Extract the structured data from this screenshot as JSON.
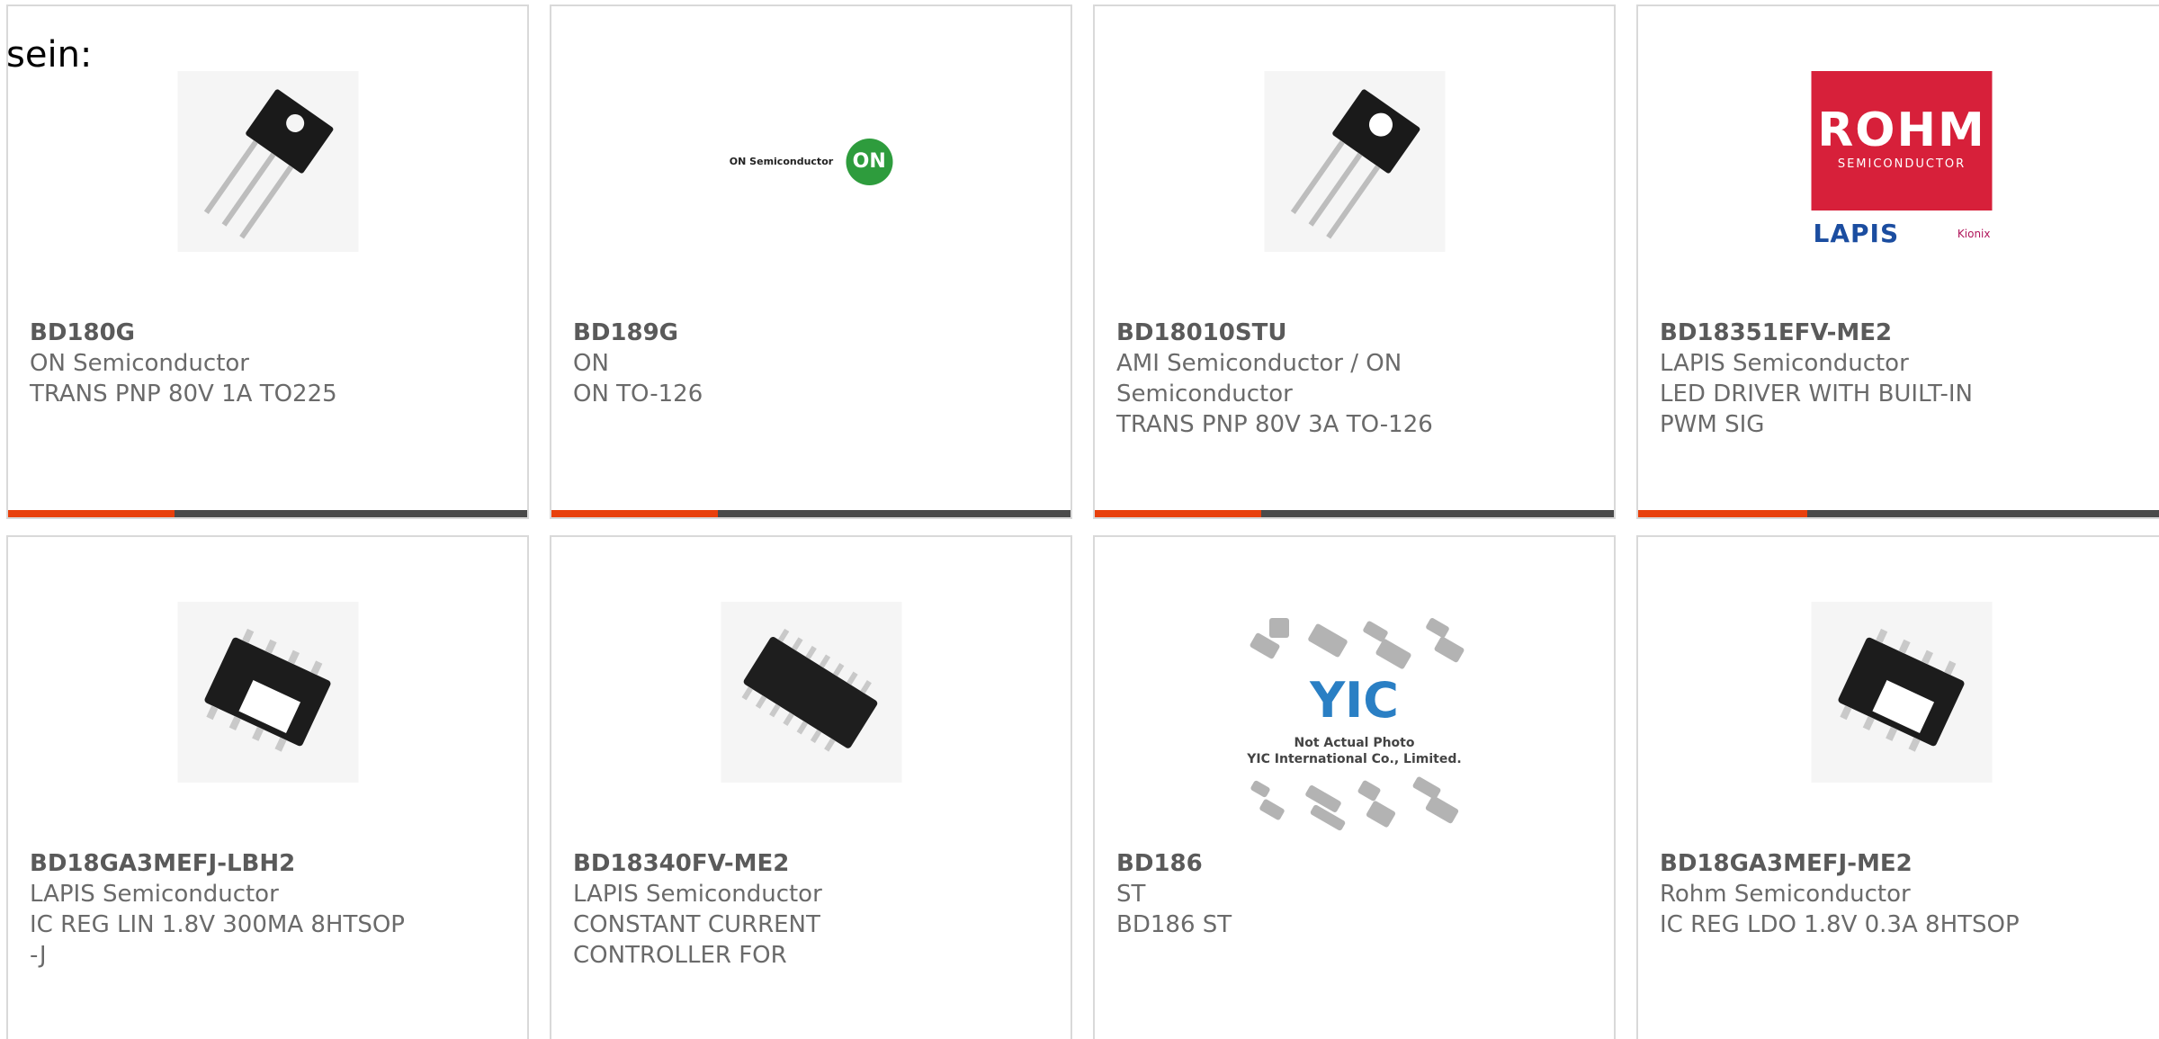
{
  "lead_text": "sein:",
  "colors": {
    "progress_fill": "#e8400c",
    "progress_track": "#4a4a4a",
    "border": "#d9d9d9"
  },
  "cards": [
    {
      "part": "BD180G",
      "maker": "ON Semiconductor",
      "desc": "TRANS PNP 80V 1A TO225",
      "image": "to126-transistor-icon",
      "progress": 0.32
    },
    {
      "part": "BD189G",
      "maker": "ON",
      "desc": "ON TO-126",
      "image": "on-semiconductor-logo",
      "logo_text": "ON Semiconductor",
      "logo_badge": "ON",
      "progress": 0.32
    },
    {
      "part": "BD18010STU",
      "maker": "AMI Semiconductor / ON Semiconductor",
      "desc": "TRANS PNP 80V 3A TO-126",
      "image": "to126-transistor-icon",
      "progress": 0.32
    },
    {
      "part": "BD18351EFV-ME2",
      "maker": "LAPIS Semiconductor",
      "desc": "LED DRIVER WITH BUILT-IN PWM SIG",
      "image": "rohm-lapis-kionix-logo",
      "logo_big": "ROHM",
      "logo_small": "SEMICONDUCTOR",
      "logo_lapis": "LAPIS",
      "logo_kionix": "Kionix",
      "progress": 0.32
    },
    {
      "part": "BD18GA3MEFJ-LBH2",
      "maker": "LAPIS Semiconductor",
      "desc": "IC REG LIN 1.8V 300MA 8HTSOP-J",
      "image": "htsop-chip-icon"
    },
    {
      "part": "BD18340FV-ME2",
      "maker": "LAPIS Semiconductor",
      "desc": "CONSTANT CURRENT CONTROLLER FOR",
      "image": "tssop-chip-icon"
    },
    {
      "part": "BD186",
      "maker": "ST",
      "desc": "BD186 ST",
      "image": "yic-placeholder-image",
      "yic_mark": "YIC",
      "yic_caption1": "Not Actual Photo",
      "yic_caption2": "YIC International Co., Limited."
    },
    {
      "part": "BD18GA3MEFJ-ME2",
      "maker": "Rohm Semiconductor",
      "desc": "IC REG LDO 1.8V 0.3A 8HTSOP",
      "image": "htsop-chip-icon"
    }
  ]
}
